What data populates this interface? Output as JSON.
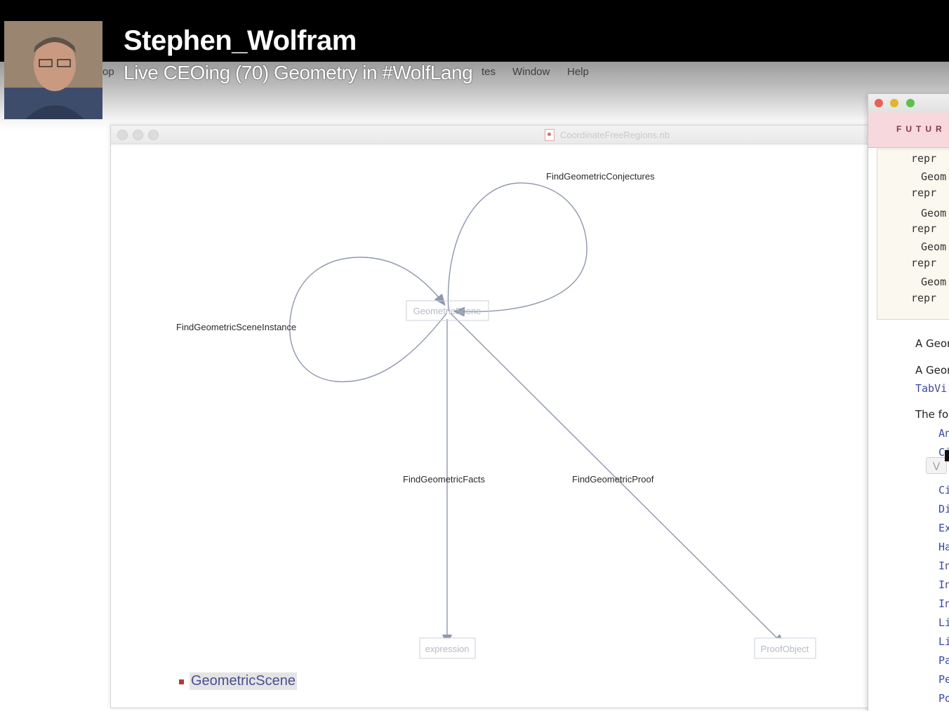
{
  "stream": {
    "title": "Stephen_Wolfram",
    "subtitle": "Live CEOing (70) Geometry in #WolfLang"
  },
  "menubar": {
    "items": [
      "Window",
      "Help"
    ]
  },
  "notebook": {
    "title": "CoordinateFreeRegions.nb",
    "graph": {
      "nodes": [
        "GeometricScene",
        "expression",
        "ProofObject"
      ],
      "edges": [
        {
          "label": "FindGeometricConjectures",
          "from": "GeometricScene",
          "to": "GeometricScene"
        },
        {
          "label": "FindGeometricSceneInstance",
          "from": "GeometricScene",
          "to": "GeometricScene"
        },
        {
          "label": "FindGeometricFacts",
          "from": "GeometricScene",
          "to": "expression"
        },
        {
          "label": "FindGeometricProof",
          "from": "GeometricScene",
          "to": "ProofObject"
        }
      ]
    },
    "scene_item": "GeometricScene"
  },
  "docs": {
    "banner": "FUTUR",
    "box_lines": [
      "repr",
      "Geom",
      "repr",
      "Geom",
      "repr",
      "Geom",
      "repr",
      "Geom",
      "repr"
    ],
    "paragraphs": [
      "A Geor",
      "A Geor",
      "TabVi",
      "The fo"
    ],
    "list_items": [
      "An",
      "Ci",
      "Ci",
      "Di",
      "Ex",
      "Ha",
      "In",
      "In",
      "In",
      "Li",
      "Li",
      "Pa",
      "Pe",
      "Po"
    ],
    "colors": {
      "close": "#ec5f56",
      "minimize": "#e5b330",
      "zoom": "#5cc04a"
    }
  }
}
